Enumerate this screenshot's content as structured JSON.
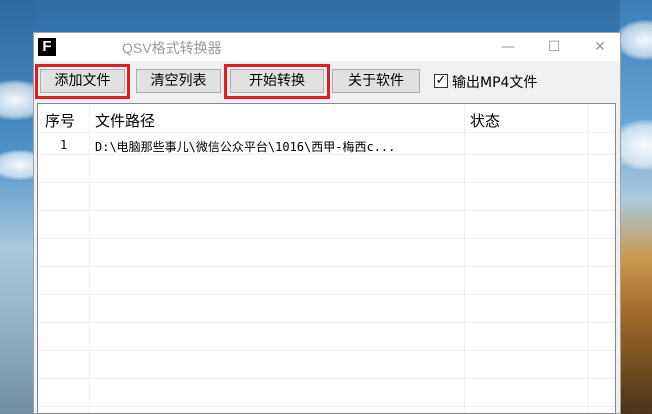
{
  "window": {
    "icon_letter": "F",
    "title": "QSV格式转换器",
    "controls": {
      "minimize": "—",
      "maximize": "☐",
      "close": "✕"
    }
  },
  "toolbar": {
    "add_file": "添加文件",
    "clear_list": "清空列表",
    "start_convert": "开始转换",
    "about": "关于软件",
    "output_mp4_label": "输出MP4文件",
    "output_mp4_checked": true,
    "output_mp4_mark": "✓"
  },
  "list": {
    "columns": [
      "序号",
      "文件路径",
      "状态"
    ],
    "rows": [
      {
        "index": "1",
        "path": "D:\\电脑那些事儿\\微信公众平台\\1016\\西甲-梅西c...",
        "status": ""
      }
    ]
  },
  "colors": {
    "highlight": "#e31b23"
  }
}
